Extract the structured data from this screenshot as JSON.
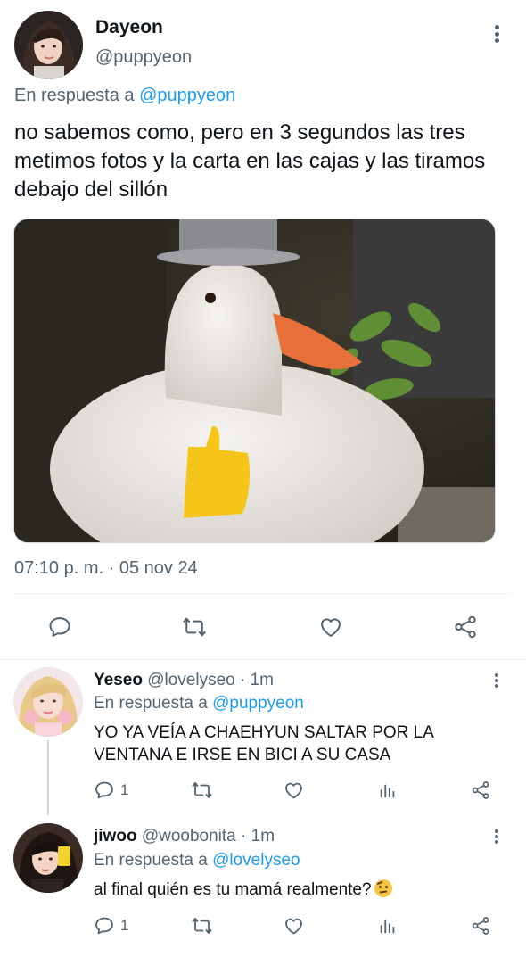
{
  "main_tweet": {
    "author_name": "Dayeon",
    "author_handle": "@puppyeon",
    "reply_prefix": "En respuesta a ",
    "reply_handle": "@puppyeon",
    "text": "no sabemos como, pero en 3 segundos las tres metimos fotos y la carta en las cajas y las tiramos debajo del sillón",
    "timestamp": "07:10 p. m. · 05 nov 24",
    "actions": [
      "reply-icon",
      "retweet-icon",
      "like-icon",
      "share-icon"
    ]
  },
  "replies": [
    {
      "name": "Yeseo",
      "handle": "@lovelyseo",
      "time": "· 1m",
      "reply_prefix": "En respuesta a ",
      "reply_handle": "@puppyeon",
      "text": "YO YA VEÍA A CHAEHYUN SALTAR POR LA VENTANA E IRSE EN BICI A SU CASA",
      "reply_count": "1"
    },
    {
      "name": "jiwoo",
      "handle": "@woobonita",
      "time": "· 1m",
      "reply_prefix": "En respuesta a ",
      "reply_handle": "@lovelyseo",
      "text": "al final quién es tu mamá realmente?",
      "reply_count": "1"
    }
  ],
  "colors": {
    "link": "#1d9bf0",
    "muted": "#536471",
    "text": "#0f1419"
  }
}
